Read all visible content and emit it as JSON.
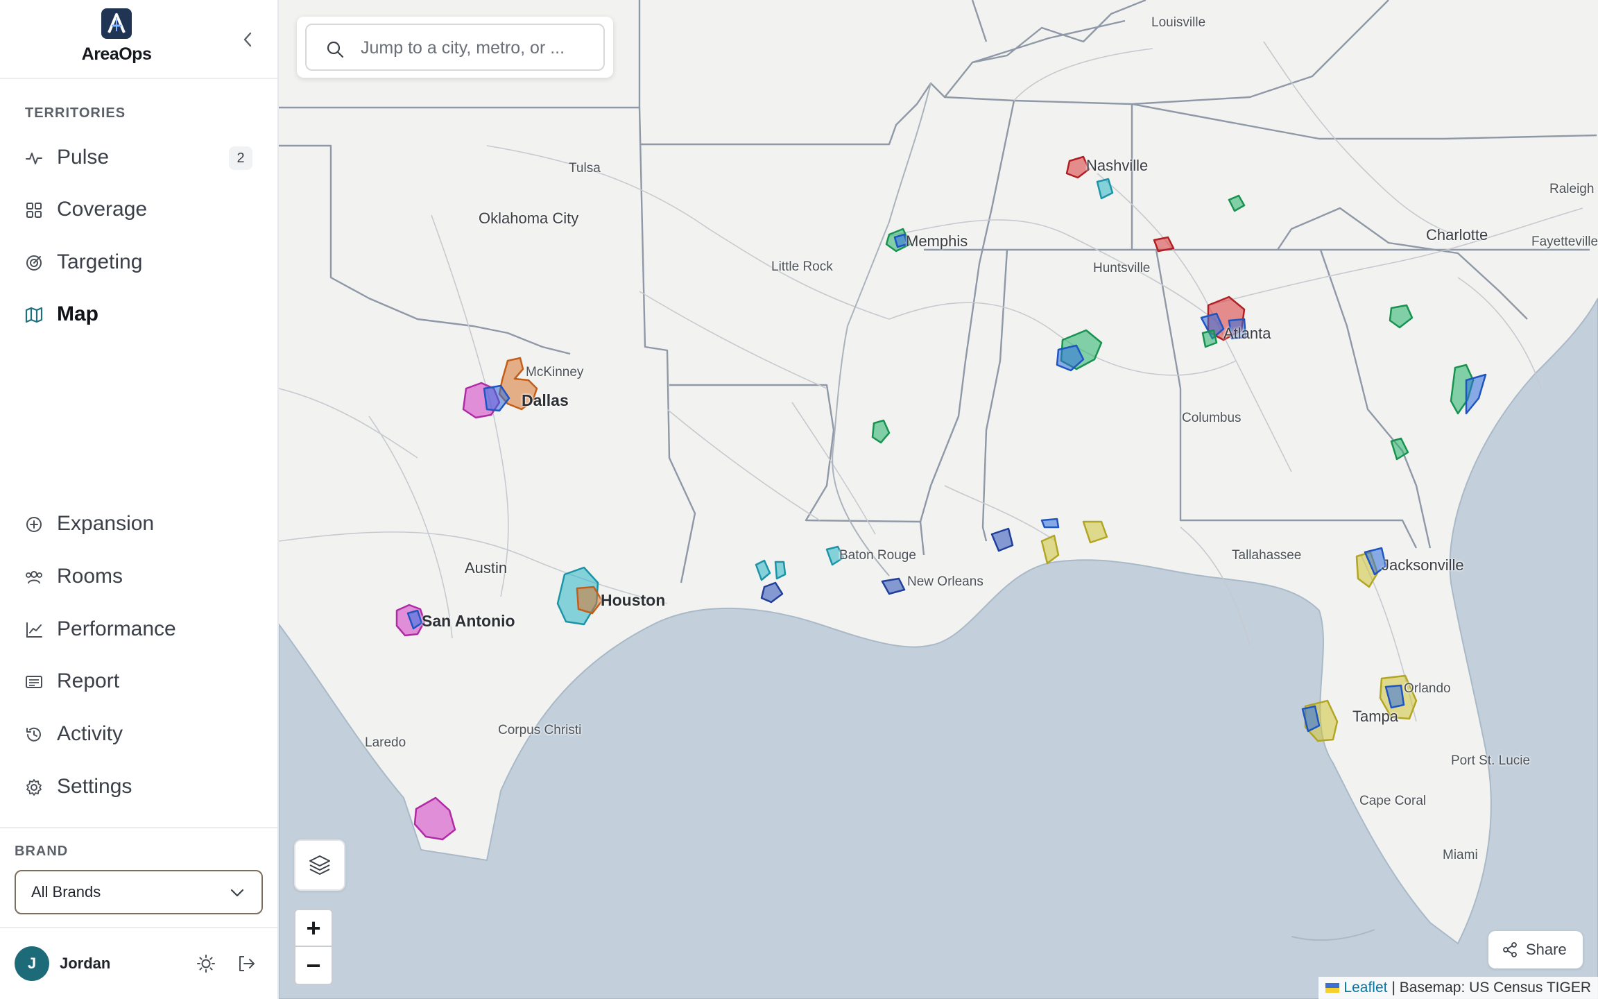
{
  "app": {
    "name": "AreaOps"
  },
  "sidebar": {
    "section_territories": "TERRITORIES",
    "primary_items": [
      {
        "label": "Pulse",
        "icon": "pulse-icon",
        "badge": "2"
      },
      {
        "label": "Coverage",
        "icon": "grid-icon"
      },
      {
        "label": "Targeting",
        "icon": "target-icon"
      },
      {
        "label": "Map",
        "icon": "map-icon",
        "active": true
      }
    ],
    "secondary_items": [
      {
        "label": "Expansion",
        "icon": "plus-circle-icon"
      },
      {
        "label": "Rooms",
        "icon": "users-icon"
      },
      {
        "label": "Performance",
        "icon": "chart-line-icon"
      },
      {
        "label": "Report",
        "icon": "report-icon"
      },
      {
        "label": "Activity",
        "icon": "history-icon"
      },
      {
        "label": "Settings",
        "icon": "gear-icon"
      }
    ],
    "brand_label": "BRAND",
    "brand_selected": "All Brands",
    "user": {
      "initial": "J",
      "name": "Jordan"
    }
  },
  "map": {
    "search_placeholder": "Jump to a city, metro, or ...",
    "share_label": "Share",
    "attribution": {
      "leaflet": "Leaflet",
      "basemap": "| Basemap: US Census TIGER"
    },
    "cities": {
      "louisville": "Louisville",
      "nashville": "Nashville",
      "raleigh": "Raleigh",
      "tulsa": "Tulsa",
      "oklahoma_city": "Oklahoma City",
      "memphis": "Memphis",
      "little_rock": "Little Rock",
      "huntsville": "Huntsville",
      "charlotte": "Charlotte",
      "fayetteville": "Fayetteville",
      "atlanta": "Atlanta",
      "mckinney": "McKinney",
      "dallas": "Dallas",
      "columbus": "Columbus",
      "baton_rouge": "Baton Rouge",
      "tallahassee": "Tallahassee",
      "jacksonville": "Jacksonville",
      "austin": "Austin",
      "new_orleans": "New Orleans",
      "houston": "Houston",
      "san_antonio": "San Antonio",
      "orlando": "Orlando",
      "tampa": "Tampa",
      "corpus_christi": "Corpus Christi",
      "laredo": "Laredo",
      "port_st_lucie": "Port St. Lucie",
      "cape_coral": "Cape Coral",
      "miami": "Miami"
    },
    "territory_colors": {
      "red": "#d8363a",
      "blue": "#2f6fe0",
      "green": "#25b36a",
      "teal": "#2ab7c9",
      "orange": "#d7772f",
      "magenta": "#d43cc6",
      "yellow": "#cfc53a",
      "navy": "#2a4fb8"
    }
  }
}
